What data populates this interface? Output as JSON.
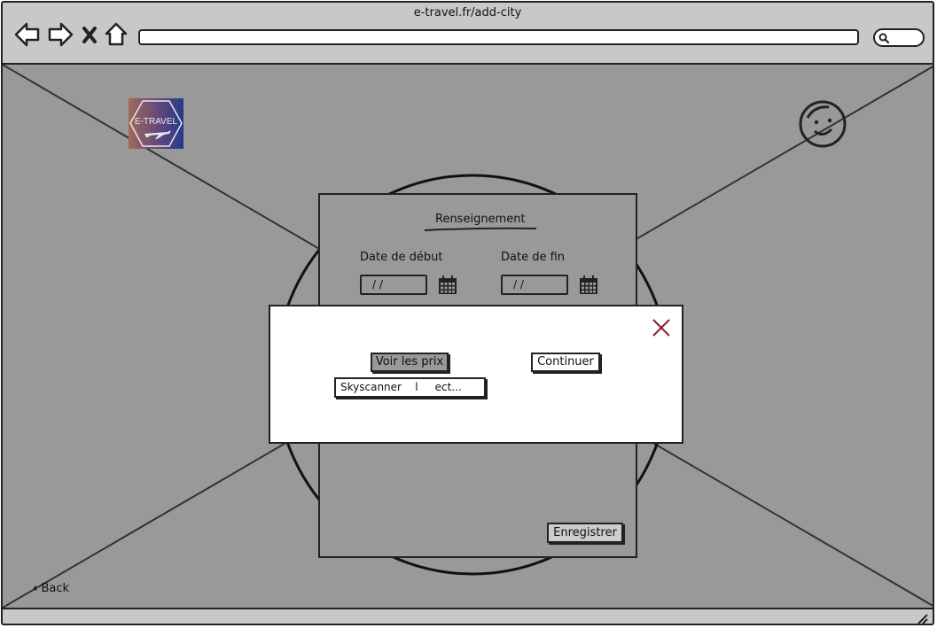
{
  "browser": {
    "url": "e-travel.fr/add-city"
  },
  "header": {
    "logo_text": "E-TRAVEL"
  },
  "form": {
    "title": "Renseignement",
    "start_label": "Date de début",
    "end_label": "Date de fin",
    "start_value": "/  /",
    "end_value": "/  /",
    "save_label": "Enregistrer"
  },
  "modal": {
    "prices_label": "Voir les prix",
    "continue_label": "Continuer",
    "sources_text": "Skyscanner    l     ect..."
  },
  "footer": {
    "back_label": "Back"
  },
  "colors": {
    "accent_close": "#8b1a2a",
    "content_bg": "#999999",
    "chrome_bg": "#c8c8c8"
  }
}
